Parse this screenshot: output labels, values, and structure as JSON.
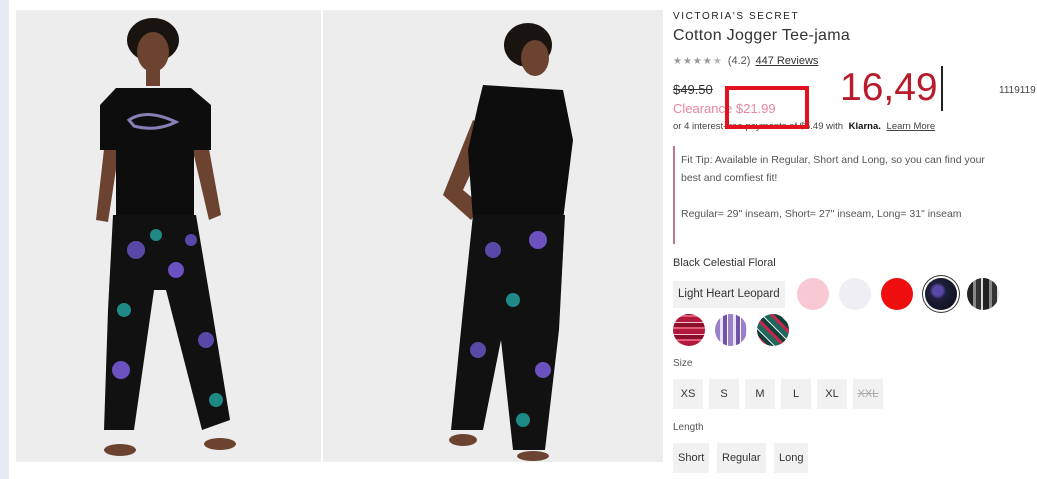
{
  "product": {
    "brand": "VICTORIA'S SECRET",
    "title": "Cotton Jogger Tee-jama",
    "rating_value": "(4.2)",
    "rating_stars": 4.2,
    "reviews_link": "447 Reviews",
    "original_price": "$49.50",
    "clearance_price": "Clearance $21.99",
    "klarna": {
      "prefix": "or 4 interest-free payments of $5.49 with",
      "brand": "Klarna.",
      "learn_more": "Learn More"
    },
    "fit_tip": {
      "line1": "Fit Tip: Available in Regular, Short and Long, so you can find your",
      "line2": "best and comfiest fit!",
      "line3": "Regular= 29\" inseam, Short= 27\" inseam, Long= 31\" inseam"
    }
  },
  "annotation": {
    "big_number": "16,49",
    "sku": "1119119",
    "highlight_color": "#e3101e"
  },
  "colors": {
    "selected_label": "Black Celestial Floral",
    "leopard_button": "Light Heart Leopard",
    "swatches": [
      {
        "name": "pink",
        "fill": "#f9c9d3"
      },
      {
        "name": "white",
        "fill": "#eeeef3"
      },
      {
        "name": "red",
        "fill": "#ef0e0e"
      },
      {
        "name": "black-celestial-floral",
        "fill": "#1d1f3a",
        "selected": true
      },
      {
        "name": "black-gray-plaid",
        "fill": "#4a4a4a"
      },
      {
        "name": "red-plaid",
        "fill": "#b11a3c"
      },
      {
        "name": "purple-plaid",
        "fill": "#9b7fc9"
      },
      {
        "name": "green-red-plaid",
        "fill": "#1e6a5e"
      }
    ]
  },
  "size": {
    "label": "Size",
    "options": [
      "XS",
      "S",
      "M",
      "L",
      "XL",
      "XXL"
    ],
    "unavailable": [
      "XXL"
    ]
  },
  "length": {
    "label": "Length",
    "options": [
      "Short",
      "Regular",
      "Long"
    ]
  },
  "theme": {
    "sale_color": "#e6859e",
    "fit_tip_border": "#b9788c",
    "annotation_text": "#b81c2c"
  }
}
